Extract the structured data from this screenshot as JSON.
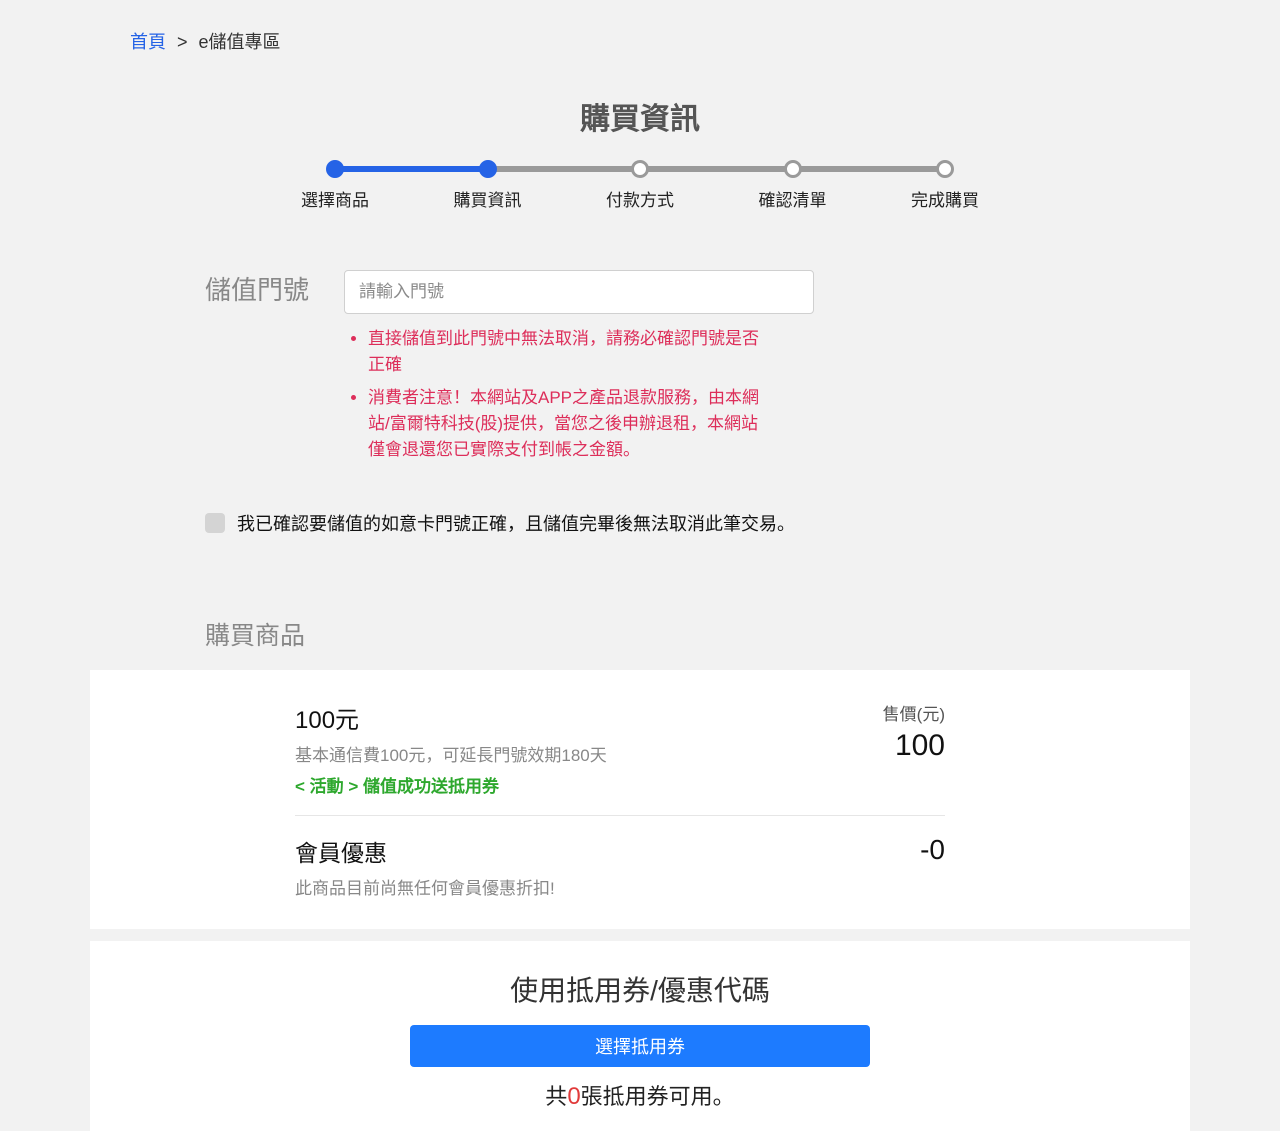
{
  "breadcrumb": {
    "home": "首頁",
    "sep": ">",
    "current": "e儲值專區"
  },
  "page_title": "購買資訊",
  "steps": [
    "選擇商品",
    "購買資訊",
    "付款方式",
    "確認清單",
    "完成購買"
  ],
  "phone": {
    "label": "儲值門號",
    "placeholder": "請輸入門號",
    "notes": [
      "直接儲值到此門號中無法取消，請務必確認門號是否正確",
      "消費者注意！本網站及APP之產品退款服務，由本網站/富爾特科技(股)提供，當您之後申辦退租，本網站僅會退還您已實際支付到帳之金額。"
    ]
  },
  "confirm_text": "我已確認要儲值的如意卡門號正確，且儲值完畢後無法取消此筆交易。",
  "product_section": {
    "heading": "購買商品",
    "name": "100元",
    "desc": "基本通信費100元，可延長門號效期180天",
    "promo": "< 活動 > 儲值成功送抵用券",
    "price_label": "售價(元)",
    "price_value": "100",
    "member_title": "會員優惠",
    "member_desc": "此商品目前尚無任何會員優惠折扣!",
    "member_discount": "-0"
  },
  "voucher": {
    "title": "使用抵用券/優惠代碼",
    "button": "選擇抵用券",
    "count_prefix": "共",
    "count_value": "0",
    "count_suffix": "張抵用券可用。"
  }
}
